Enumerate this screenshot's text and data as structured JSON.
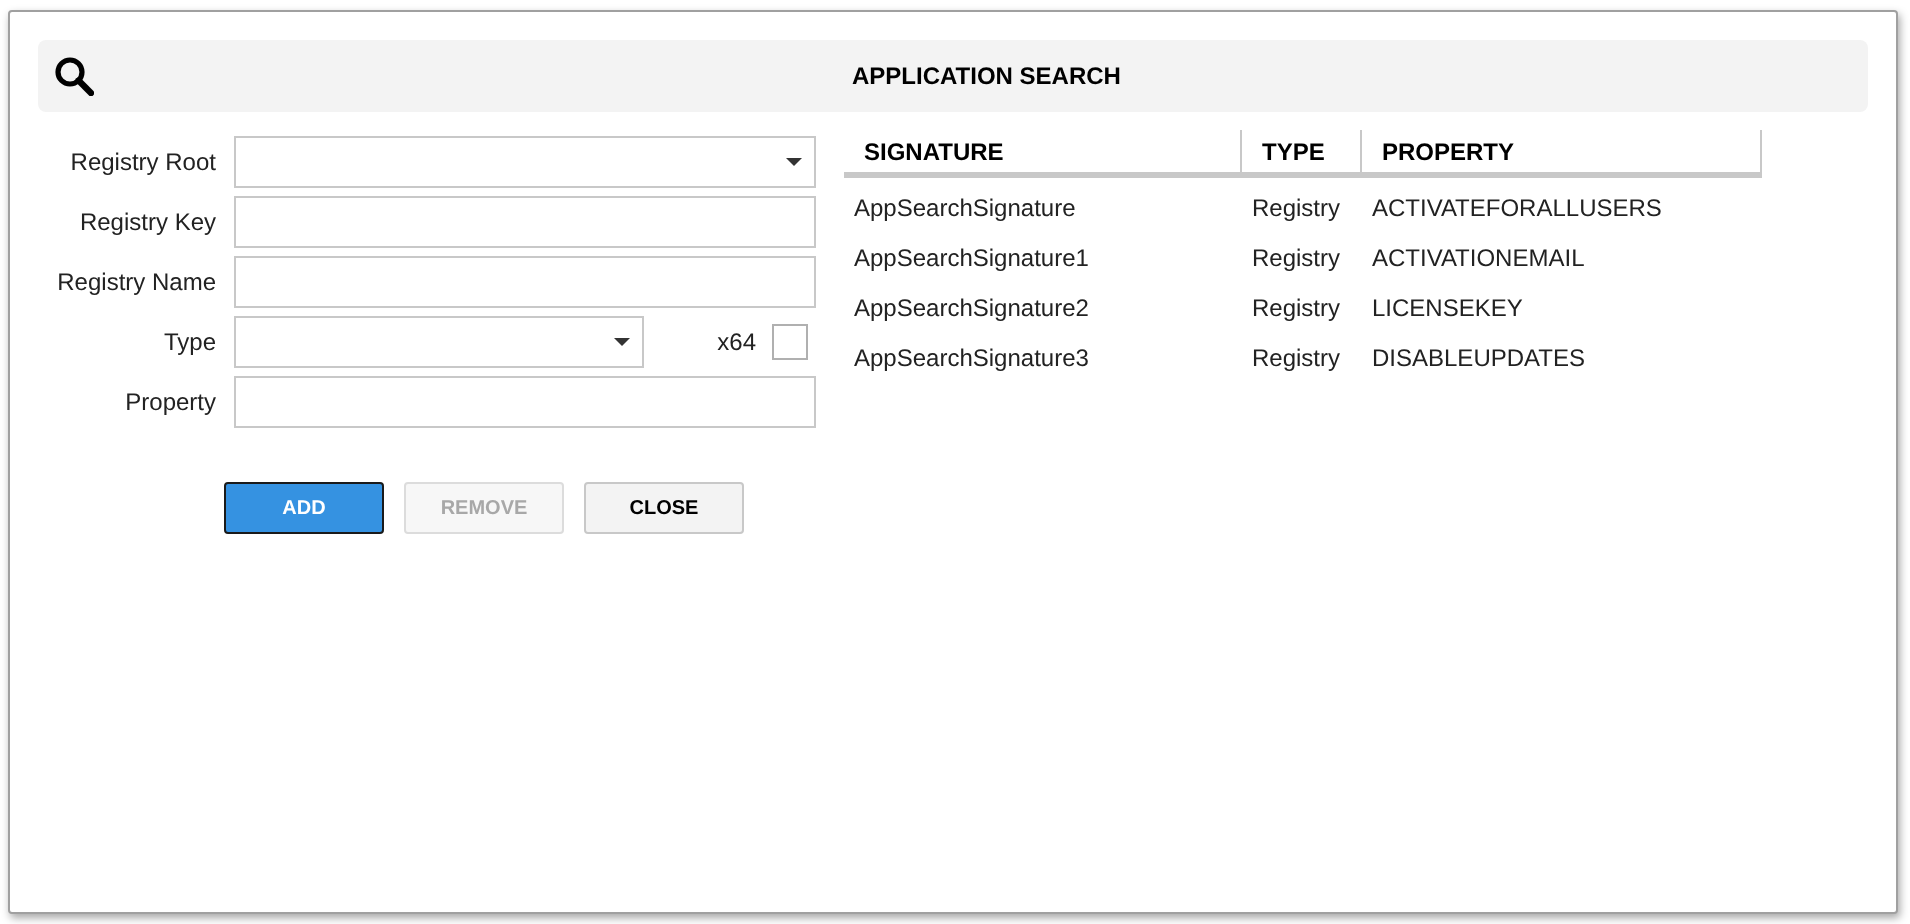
{
  "header": {
    "title": "APPLICATION SEARCH"
  },
  "form": {
    "fields": [
      {
        "label": "Registry Root",
        "kind": "dropdown"
      },
      {
        "label": "Registry Key",
        "kind": "text"
      },
      {
        "label": "Registry Name",
        "kind": "text"
      },
      {
        "label": "Type",
        "kind": "dropdown",
        "checkbox": {
          "label": "x64",
          "checked": false
        }
      },
      {
        "label": "Property",
        "kind": "text"
      }
    ],
    "buttons": [
      {
        "label": "ADD",
        "kind": "primary",
        "disabled": false
      },
      {
        "label": "REMOVE",
        "kind": "default",
        "disabled": true
      },
      {
        "label": "CLOSE",
        "kind": "default",
        "disabled": false
      }
    ]
  },
  "table": {
    "columns": [
      "SIGNATURE",
      "TYPE",
      "PROPERTY"
    ],
    "rows": [
      [
        "AppSearchSignature",
        "Registry",
        "ACTIVATEFORALLUSERS"
      ],
      [
        "AppSearchSignature1",
        "Registry",
        "ACTIVATIONEMAIL"
      ],
      [
        "AppSearchSignature2",
        "Registry",
        "LICENSEKEY"
      ],
      [
        "AppSearchSignature3",
        "Registry",
        "DISABLEUPDATES"
      ]
    ]
  }
}
